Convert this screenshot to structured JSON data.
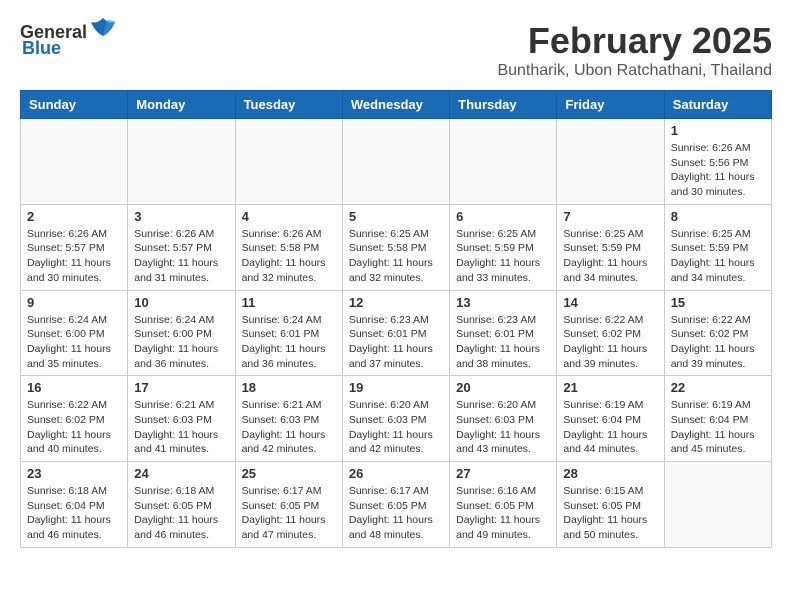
{
  "header": {
    "logo_general": "General",
    "logo_blue": "Blue",
    "month": "February 2025",
    "location": "Buntharik, Ubon Ratchathani, Thailand"
  },
  "days_of_week": [
    "Sunday",
    "Monday",
    "Tuesday",
    "Wednesday",
    "Thursday",
    "Friday",
    "Saturday"
  ],
  "weeks": [
    [
      {
        "day": "",
        "info": ""
      },
      {
        "day": "",
        "info": ""
      },
      {
        "day": "",
        "info": ""
      },
      {
        "day": "",
        "info": ""
      },
      {
        "day": "",
        "info": ""
      },
      {
        "day": "",
        "info": ""
      },
      {
        "day": "1",
        "info": "Sunrise: 6:26 AM\nSunset: 5:56 PM\nDaylight: 11 hours and 30 minutes."
      }
    ],
    [
      {
        "day": "2",
        "info": "Sunrise: 6:26 AM\nSunset: 5:57 PM\nDaylight: 11 hours and 30 minutes."
      },
      {
        "day": "3",
        "info": "Sunrise: 6:26 AM\nSunset: 5:57 PM\nDaylight: 11 hours and 31 minutes."
      },
      {
        "day": "4",
        "info": "Sunrise: 6:26 AM\nSunset: 5:58 PM\nDaylight: 11 hours and 32 minutes."
      },
      {
        "day": "5",
        "info": "Sunrise: 6:25 AM\nSunset: 5:58 PM\nDaylight: 11 hours and 32 minutes."
      },
      {
        "day": "6",
        "info": "Sunrise: 6:25 AM\nSunset: 5:59 PM\nDaylight: 11 hours and 33 minutes."
      },
      {
        "day": "7",
        "info": "Sunrise: 6:25 AM\nSunset: 5:59 PM\nDaylight: 11 hours and 34 minutes."
      },
      {
        "day": "8",
        "info": "Sunrise: 6:25 AM\nSunset: 5:59 PM\nDaylight: 11 hours and 34 minutes."
      }
    ],
    [
      {
        "day": "9",
        "info": "Sunrise: 6:24 AM\nSunset: 6:00 PM\nDaylight: 11 hours and 35 minutes."
      },
      {
        "day": "10",
        "info": "Sunrise: 6:24 AM\nSunset: 6:00 PM\nDaylight: 11 hours and 36 minutes."
      },
      {
        "day": "11",
        "info": "Sunrise: 6:24 AM\nSunset: 6:01 PM\nDaylight: 11 hours and 36 minutes."
      },
      {
        "day": "12",
        "info": "Sunrise: 6:23 AM\nSunset: 6:01 PM\nDaylight: 11 hours and 37 minutes."
      },
      {
        "day": "13",
        "info": "Sunrise: 6:23 AM\nSunset: 6:01 PM\nDaylight: 11 hours and 38 minutes."
      },
      {
        "day": "14",
        "info": "Sunrise: 6:22 AM\nSunset: 6:02 PM\nDaylight: 11 hours and 39 minutes."
      },
      {
        "day": "15",
        "info": "Sunrise: 6:22 AM\nSunset: 6:02 PM\nDaylight: 11 hours and 39 minutes."
      }
    ],
    [
      {
        "day": "16",
        "info": "Sunrise: 6:22 AM\nSunset: 6:02 PM\nDaylight: 11 hours and 40 minutes."
      },
      {
        "day": "17",
        "info": "Sunrise: 6:21 AM\nSunset: 6:03 PM\nDaylight: 11 hours and 41 minutes."
      },
      {
        "day": "18",
        "info": "Sunrise: 6:21 AM\nSunset: 6:03 PM\nDaylight: 11 hours and 42 minutes."
      },
      {
        "day": "19",
        "info": "Sunrise: 6:20 AM\nSunset: 6:03 PM\nDaylight: 11 hours and 42 minutes."
      },
      {
        "day": "20",
        "info": "Sunrise: 6:20 AM\nSunset: 6:03 PM\nDaylight: 11 hours and 43 minutes."
      },
      {
        "day": "21",
        "info": "Sunrise: 6:19 AM\nSunset: 6:04 PM\nDaylight: 11 hours and 44 minutes."
      },
      {
        "day": "22",
        "info": "Sunrise: 6:19 AM\nSunset: 6:04 PM\nDaylight: 11 hours and 45 minutes."
      }
    ],
    [
      {
        "day": "23",
        "info": "Sunrise: 6:18 AM\nSunset: 6:04 PM\nDaylight: 11 hours and 46 minutes."
      },
      {
        "day": "24",
        "info": "Sunrise: 6:18 AM\nSunset: 6:05 PM\nDaylight: 11 hours and 46 minutes."
      },
      {
        "day": "25",
        "info": "Sunrise: 6:17 AM\nSunset: 6:05 PM\nDaylight: 11 hours and 47 minutes."
      },
      {
        "day": "26",
        "info": "Sunrise: 6:17 AM\nSunset: 6:05 PM\nDaylight: 11 hours and 48 minutes."
      },
      {
        "day": "27",
        "info": "Sunrise: 6:16 AM\nSunset: 6:05 PM\nDaylight: 11 hours and 49 minutes."
      },
      {
        "day": "28",
        "info": "Sunrise: 6:15 AM\nSunset: 6:05 PM\nDaylight: 11 hours and 50 minutes."
      },
      {
        "day": "",
        "info": ""
      }
    ]
  ]
}
